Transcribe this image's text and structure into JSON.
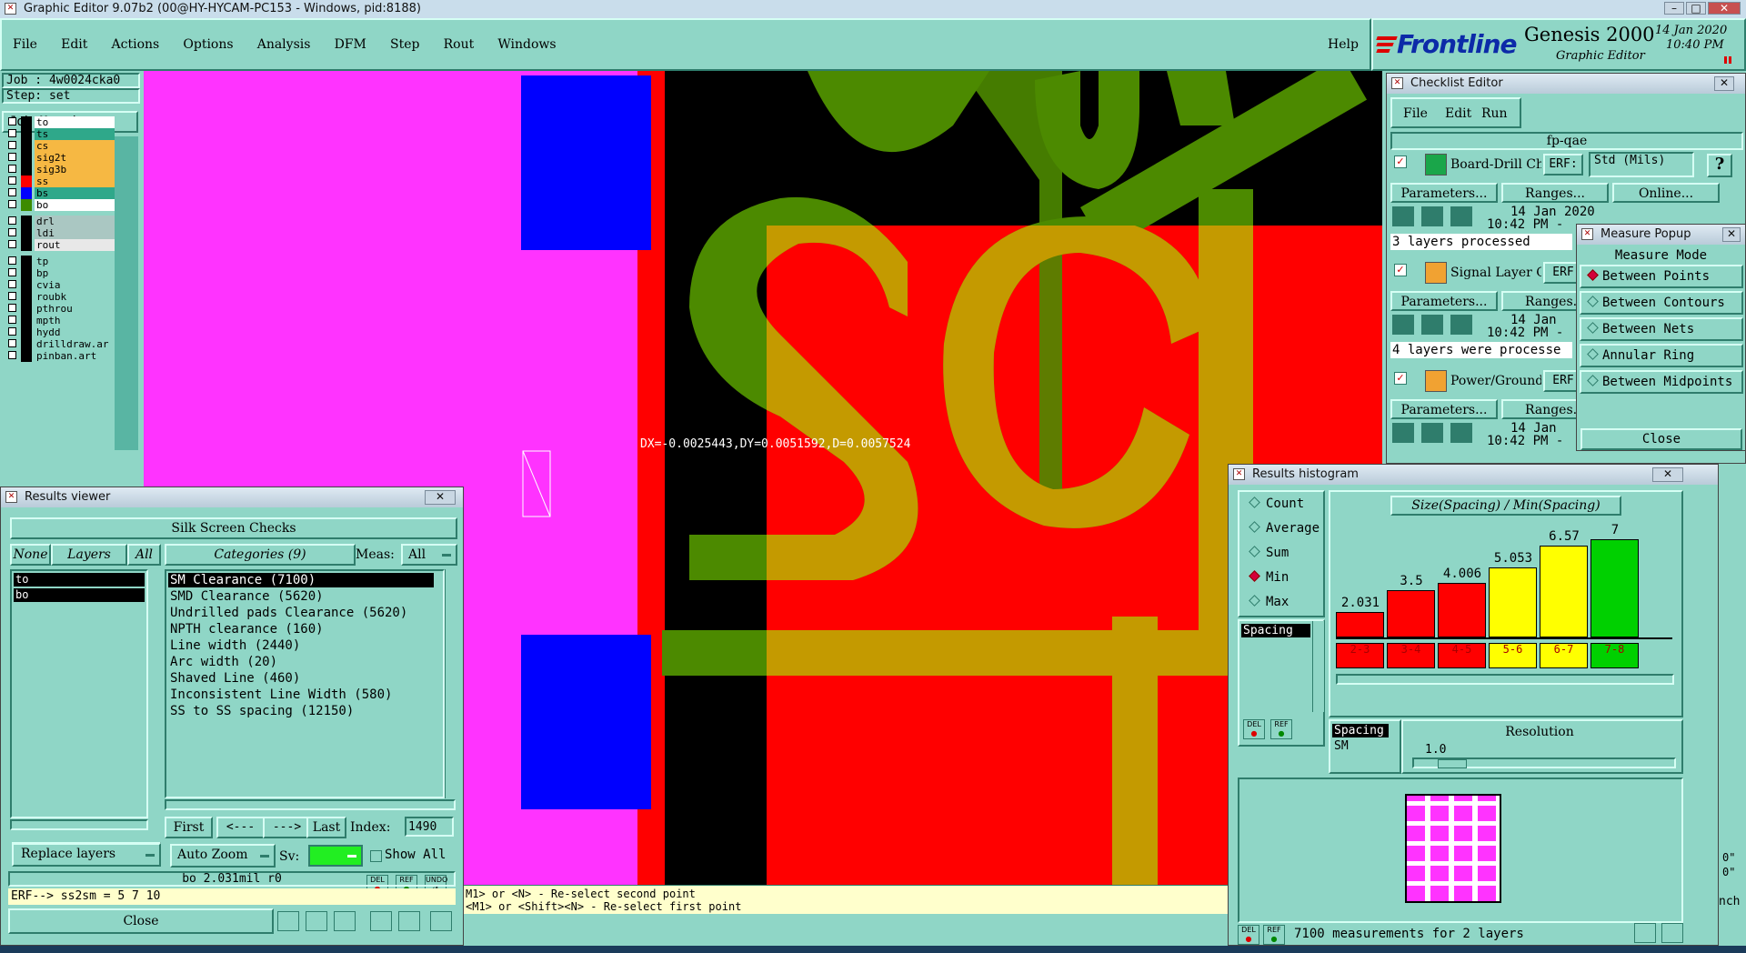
{
  "window": {
    "title": "Graphic Editor 9.07b2 (00@HY-HYCAM-PC153 - Windows, pid:8188)",
    "menu": [
      "File",
      "Edit",
      "Actions",
      "Options",
      "Analysis",
      "DFM",
      "Step",
      "Rout",
      "Windows"
    ],
    "help": "Help"
  },
  "brand": {
    "logo": "Frontline",
    "product": "Genesis 2000",
    "subtitle": "Graphic Editor",
    "date": "14 Jan 2020",
    "time": "10:40 PM"
  },
  "job": {
    "job_label": "Job : 4w0024cka0",
    "step_label": "Step: set",
    "matrix_button": "Job Matrix ..."
  },
  "layers": [
    {
      "name": "to",
      "color": "#ffffff",
      "swatch": "#000000"
    },
    {
      "name": "ts",
      "color": "#2fa88a",
      "swatch": "#000000"
    },
    {
      "name": "cs",
      "color": "#f6b843",
      "swatch": "#000000"
    },
    {
      "name": "sig2t",
      "color": "#f6b843",
      "swatch": "#000000"
    },
    {
      "name": "sig3b",
      "color": "#f6b843",
      "swatch": "#000000"
    },
    {
      "name": "ss",
      "color": "#f6b843",
      "swatch": "#ff0000"
    },
    {
      "name": "bs",
      "color": "#2fa88a",
      "swatch": "#0000ff"
    },
    {
      "name": "bo",
      "color": "#ffffff",
      "swatch": "#3c8b00"
    },
    {
      "name": "drl",
      "color": "#aac7c2",
      "swatch": "#000000"
    },
    {
      "name": "ldi",
      "color": "#aac7c2",
      "swatch": "#000000"
    },
    {
      "name": "rout",
      "color": "#e8e8e8",
      "swatch": "#000000"
    },
    {
      "name": "tp",
      "color": "#8fd6c6",
      "swatch": "#000000"
    },
    {
      "name": "bp",
      "color": "#8fd6c6",
      "swatch": "#000000"
    },
    {
      "name": "cvia",
      "color": "#8fd6c6",
      "swatch": "#000000"
    },
    {
      "name": "roubk",
      "color": "#8fd6c6",
      "swatch": "#000000"
    },
    {
      "name": "pthrou",
      "color": "#8fd6c6",
      "swatch": "#000000"
    },
    {
      "name": "mpth",
      "color": "#8fd6c6",
      "swatch": "#000000"
    },
    {
      "name": "hydd",
      "color": "#8fd6c6",
      "swatch": "#000000"
    },
    {
      "name": "drilldraw.ar",
      "color": "#8fd6c6",
      "swatch": "#000000"
    },
    {
      "name": "pinban.art",
      "color": "#8fd6c6",
      "swatch": "#000000"
    }
  ],
  "canvas": {
    "measure_text": "DX=-0.0025443,DY=0.0051592,D=0.0057524"
  },
  "results_viewer": {
    "title": "Results viewer",
    "header": "Silk Screen Checks",
    "none": "None",
    "layers": "Layers",
    "all": "All",
    "categories_label": "Categories (9)",
    "meas_label": "Meas:",
    "meas_value": "All",
    "layer_list": [
      "to",
      "bo"
    ],
    "categories": [
      "SM Clearance (7100)",
      "SMD Clearance (5620)",
      "Undrilled pads Clearance (5620)",
      "NPTH clearance (160)",
      "Line width (2440)",
      "Arc width (20)",
      "Shaved Line (460)",
      "Inconsistent Line Width (580)",
      "SS to SS spacing (12150)"
    ],
    "first": "First",
    "prev": "<---",
    "next": "--->",
    "last": "Last",
    "index_label": "Index:",
    "index_value": "1490",
    "auto_zoom": "Auto Zoom",
    "sv_label": "Sv:",
    "show_all": "Show All",
    "replace_layers": "Replace layers",
    "status": "bo 2.031mil  r0",
    "erf_line": "ERF--> ss2sm = 5 7 10",
    "close": "Close",
    "del": "DEL",
    "ref": "REF",
    "undo": "UNDO"
  },
  "hint_lines": [
    "M1> or <N> - Re-select second point",
    "<M1> or <Shift><N> - Re-select first point"
  ],
  "checklist_editor": {
    "title": "Checklist Editor",
    "menu": [
      "File",
      "Edit",
      "Run"
    ],
    "name": "fp-qae",
    "checks": [
      {
        "name": "Board-Drill Che",
        "erf_label": "ERF:",
        "erf_value": "Std (Mils)",
        "date": "14 Jan 2020",
        "time": "10:42 PM -",
        "msg": "3 layers processed"
      },
      {
        "name": "Signal Layer Ch",
        "erf_label": "ERF",
        "erf_value": "",
        "date": "14 Jan",
        "time": "10:42 PM -",
        "msg": "4 layers were processe"
      },
      {
        "name": "Power/Ground C",
        "erf_label": "ERF",
        "erf_value": "",
        "date": "14 Jan",
        "time": "10:42 PM -",
        "msg": ""
      }
    ],
    "parameters": "Parameters...",
    "ranges": "Ranges...",
    "online": "Online...",
    "help": "?"
  },
  "measure_popup": {
    "title": "Measure Popup",
    "mode_label": "Measure Mode",
    "modes": [
      "Between Points",
      "Between Contours",
      "Between Nets",
      "Annular Ring",
      "Between Midpoints"
    ],
    "selected": 0,
    "close": "Close"
  },
  "histogram": {
    "title": "Results histogram",
    "stats": [
      "Count",
      "Average",
      "Sum",
      "Min",
      "Max"
    ],
    "selected_stat": 3,
    "heading": "Size(Spacing) / Min(Spacing)",
    "list_item": "Spacing",
    "list2": [
      "Spacing",
      "SM"
    ],
    "resolution_label": "Resolution",
    "resolution_value": "1.0",
    "footer": "7100 measurements for 2 layers",
    "del": "DEL",
    "ref": "REF"
  },
  "chart_data": {
    "type": "bar",
    "title": "Size(Spacing) / Min(Spacing)",
    "categories": [
      "2-3",
      "3-4",
      "4-5",
      "5-6",
      "6-7",
      "7-8"
    ],
    "values": [
      2.031,
      3.5,
      4.006,
      5.053,
      6.57,
      7
    ],
    "value_labels": [
      "2.031",
      "3.5",
      "4.006",
      "5.053",
      "6.57",
      "7"
    ],
    "colors": [
      "#ff0000",
      "#ff0000",
      "#ff0000",
      "#ffff00",
      "#ffff00",
      "#00d000"
    ],
    "ylim": [
      0,
      7.5
    ]
  },
  "side_fragments": [
    "0\"",
    "0\"",
    "nch"
  ]
}
